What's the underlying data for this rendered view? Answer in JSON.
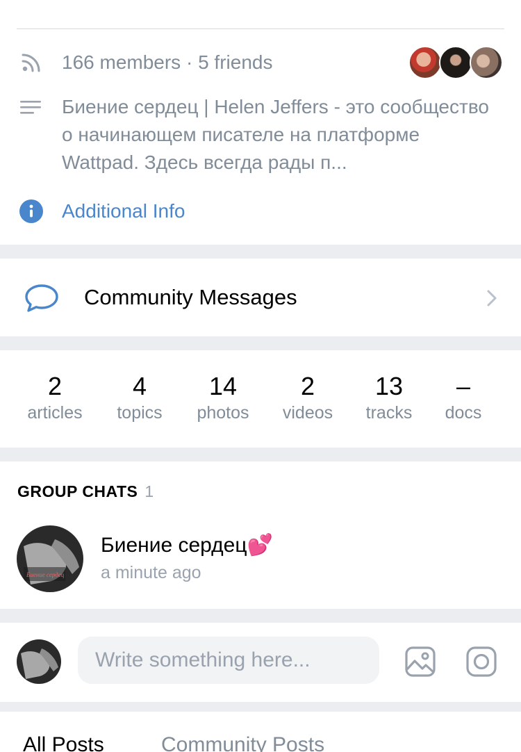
{
  "info": {
    "members_text": "166 members · 5 friends",
    "description": "Биение сердец  | Helen Jeffers - это сообщество  о  начинающем писателе на платформе Wattpad. Здесь всегда рады п...",
    "additional_info_label": "Additional Info"
  },
  "friends_avatars": [
    "friend-avatar-1",
    "friend-avatar-2",
    "friend-avatar-3"
  ],
  "messages": {
    "label": "Community Messages"
  },
  "counters": [
    {
      "value": "2",
      "label": "articles"
    },
    {
      "value": "4",
      "label": "topics"
    },
    {
      "value": "14",
      "label": "photos"
    },
    {
      "value": "2",
      "label": "videos"
    },
    {
      "value": "13",
      "label": "tracks"
    },
    {
      "value": "–",
      "label": "docs"
    }
  ],
  "group_chats": {
    "header": "GROUP CHATS",
    "count": "1",
    "chat_title": "Биение сердец💕",
    "chat_time": "a minute ago",
    "avatar_caption": "Биение сердец"
  },
  "compose": {
    "placeholder": "Write something here..."
  },
  "tabs": {
    "all": "All Posts",
    "community": "Community Posts"
  },
  "colors": {
    "accent": "#4986cc",
    "secondary_text": "#818c99",
    "background": "#ebedf0",
    "input_bg": "#f2f3f5"
  },
  "icons": {
    "members": "rss-icon",
    "description": "lines-icon",
    "additional_info": "info-icon",
    "messages": "chat-bubble-icon",
    "chevron": "chevron-right-icon",
    "photo": "photo-icon",
    "camera": "instagram-camera-icon"
  }
}
